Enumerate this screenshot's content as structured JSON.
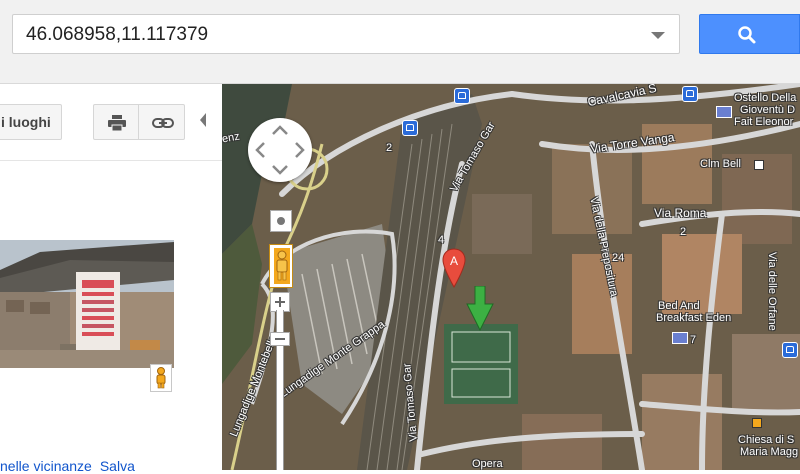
{
  "search": {
    "value": "46.068958,11.117379",
    "icon": "search-icon"
  },
  "left_panel": {
    "places_label": "i luoghi",
    "print_icon": "print-icon",
    "link_icon": "link-icon",
    "bottom_links": [
      "nelle vicinanze",
      "Salva"
    ]
  },
  "map": {
    "labels": {
      "cavalcavia": "Cavalcavia S",
      "ostello1": "Ostello Della",
      "ostello2": "Gioventù D",
      "ostello3": "Fait Eleonor",
      "via_torre_vanga": "Via Torre Vanga",
      "clm_bell": "Clm Bell",
      "via_roma": "Via Roma",
      "roma_num": "2",
      "via_santomaso1": "Via Tomaso Gar",
      "via_santomaso2": "Via Tomaso Gar",
      "via_prepositura": "Via della Prepositura",
      "num_24": "24",
      "via_orfane": "Via delle Orfane",
      "lungadige_monte_grappa": "Lungadige Monte Grappa",
      "lungadige_montebello": "Lungadige Montebello",
      "bnb1": "Bed And",
      "bnb2": "Breakfast Eden",
      "num_7": "7",
      "chiesa1": "Chiesa di S",
      "chiesa2": "Maria Magg",
      "num_4": "4",
      "num_2": "2",
      "adige_tail": "enz",
      "opera": "Opera"
    },
    "marker_letter": "A",
    "colors": {
      "marker": "#e84c3d",
      "arrow": "#3cb043",
      "accent": "#4d90fe"
    }
  }
}
